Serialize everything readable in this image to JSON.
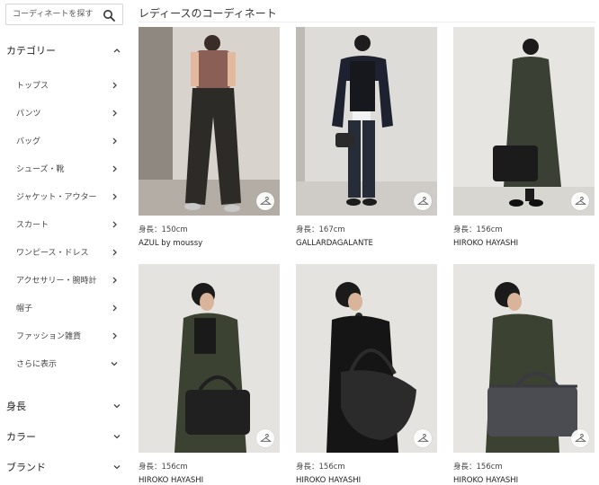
{
  "search": {
    "placeholder": "コーディネートを探す"
  },
  "sidebar": {
    "category_label": "カテゴリー",
    "items": [
      {
        "label": "トップス"
      },
      {
        "label": "パンツ"
      },
      {
        "label": "バッグ"
      },
      {
        "label": "シューズ・靴"
      },
      {
        "label": "ジャケット・アウター"
      },
      {
        "label": "スカート"
      },
      {
        "label": "ワンピース・ドレス"
      },
      {
        "label": "アクセサリー・腕時計"
      },
      {
        "label": "帽子"
      },
      {
        "label": "ファッション雑貨"
      },
      {
        "label": "さらに表示"
      }
    ],
    "filters": [
      {
        "label": "身長"
      },
      {
        "label": "カラー"
      },
      {
        "label": "ブランド"
      }
    ]
  },
  "main": {
    "title": "レディースのコーディネート",
    "cards": [
      {
        "height": "身長：150cm",
        "brand": "AZUL by moussy"
      },
      {
        "height": "身長：167cm",
        "brand": "GALLARDAGALANTE"
      },
      {
        "height": "身長：156cm",
        "brand": "HIROKO HAYASHI"
      },
      {
        "height": "身長：156cm",
        "brand": "HIROKO HAYASHI"
      },
      {
        "height": "身長：156cm",
        "brand": "HIROKO HAYASHI"
      },
      {
        "height": "身長：156cm",
        "brand": "HIROKO HAYASHI"
      }
    ]
  },
  "colors": {
    "text": "#333333",
    "border": "#d6d6d6",
    "background": "#ffffff"
  },
  "icons": {
    "search": "search-icon",
    "chevron": "chevron-icon",
    "hanger": "hanger-icon"
  }
}
